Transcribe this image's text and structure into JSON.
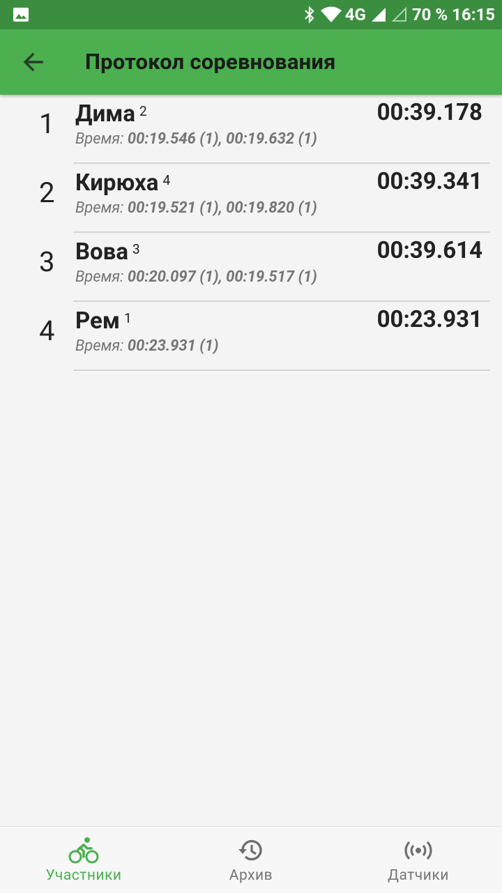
{
  "status_bar": {
    "network": "4G",
    "battery": "70 %",
    "time": "16:15"
  },
  "app_bar": {
    "title": "Протокол соревнования"
  },
  "results": [
    {
      "place": "1",
      "name": "Дима",
      "number": "2",
      "total": "00:39.178",
      "laps_label": "Время",
      "laps": "00:19.546 (1), 00:19.632 (1)"
    },
    {
      "place": "2",
      "name": "Кирюха",
      "number": "4",
      "total": "00:39.341",
      "laps_label": "Время",
      "laps": "00:19.521 (1), 00:19.820 (1)"
    },
    {
      "place": "3",
      "name": "Вова",
      "number": "3",
      "total": "00:39.614",
      "laps_label": "Время",
      "laps": "00:20.097 (1), 00:19.517 (1)"
    },
    {
      "place": "4",
      "name": "Рем",
      "number": "1",
      "total": "00:23.931",
      "laps_label": "Время",
      "laps": "00:23.931 (1)"
    }
  ],
  "bottom_nav": {
    "items": [
      {
        "label": "Участники",
        "icon": "bike-icon",
        "active": true
      },
      {
        "label": "Архив",
        "icon": "history-icon",
        "active": false
      },
      {
        "label": "Датчики",
        "icon": "sensor-icon",
        "active": false
      }
    ]
  },
  "colors": {
    "status_bar": "#3b8e3f",
    "app_bar": "#4caf50",
    "accent": "#4caf50"
  }
}
